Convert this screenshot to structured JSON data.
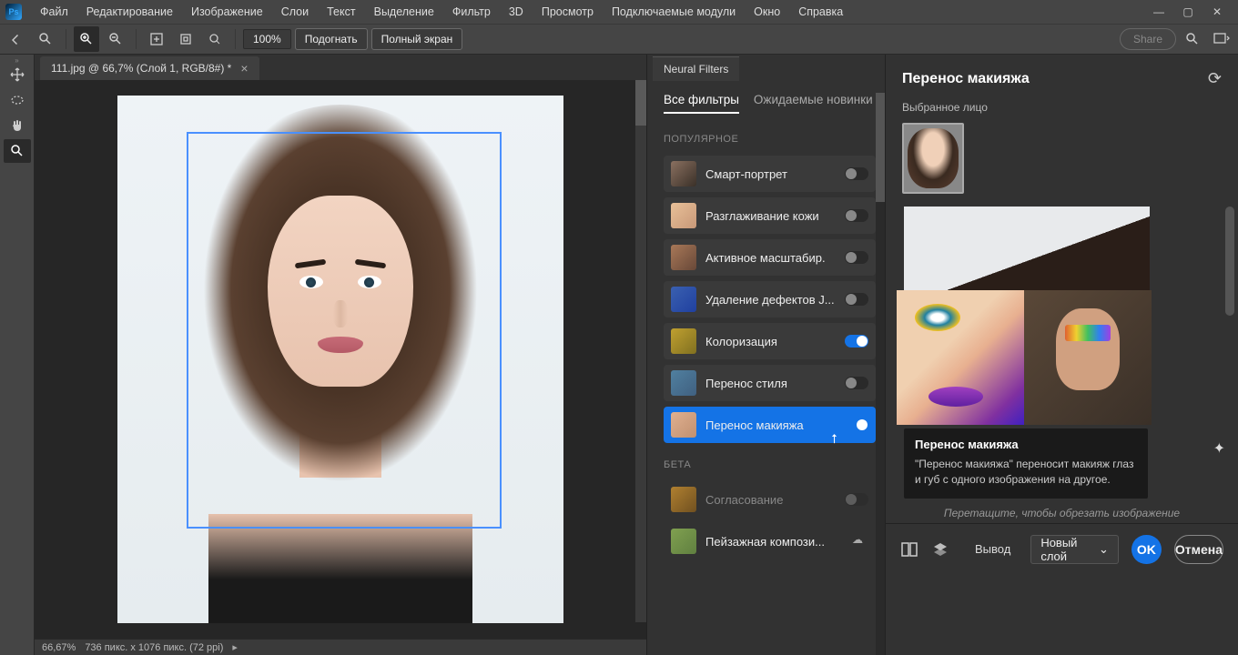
{
  "menu": [
    "Файл",
    "Редактирование",
    "Изображение",
    "Слои",
    "Текст",
    "Выделение",
    "Фильтр",
    "3D",
    "Просмотр",
    "Подключаемые модули",
    "Окно",
    "Справка"
  ],
  "options": {
    "zoom": "100%",
    "fit": "Подогнать",
    "fullscreen": "Полный экран",
    "share": "Share"
  },
  "doc": {
    "tab_title": "111.jpg @ 66,7% (Слой 1, RGB/8#) *"
  },
  "status": {
    "zoom": "66,67%",
    "dims": "736 пикс. x 1076 пикс. (72 ppi)"
  },
  "nf": {
    "tab": "Neural Filters",
    "filters_tabs": {
      "all": "Все фильтры",
      "waiting": "Ожидаемые новинки"
    },
    "section_popular": "ПОПУЛЯРНОЕ",
    "section_beta": "БЕТА",
    "items": [
      {
        "label": "Смарт-портрет",
        "on": false
      },
      {
        "label": "Разглаживание кожи",
        "on": false
      },
      {
        "label": "Активное масштабир.",
        "on": false
      },
      {
        "label": "Удаление дефектов J...",
        "on": false
      },
      {
        "label": "Колоризация",
        "on": true
      },
      {
        "label": "Перенос стиля",
        "on": false
      },
      {
        "label": "Перенос макияжа",
        "on": true
      }
    ],
    "beta_items": [
      {
        "label": "Согласование"
      },
      {
        "label": "Пейзажная компози..."
      }
    ]
  },
  "rp": {
    "title": "Перенос макияжа",
    "selected_face": "Выбранное лицо",
    "tooltip_title": "Перенос макияжа",
    "tooltip_text": "\"Перенос макияжа\" переносит макияж глаз и губ с одного изображения на другое.",
    "caption": "Перетащите, чтобы обрезать изображение"
  },
  "bottom": {
    "output": "Вывод",
    "out_value": "Новый слой",
    "ok": "OK",
    "cancel": "Отмена"
  }
}
